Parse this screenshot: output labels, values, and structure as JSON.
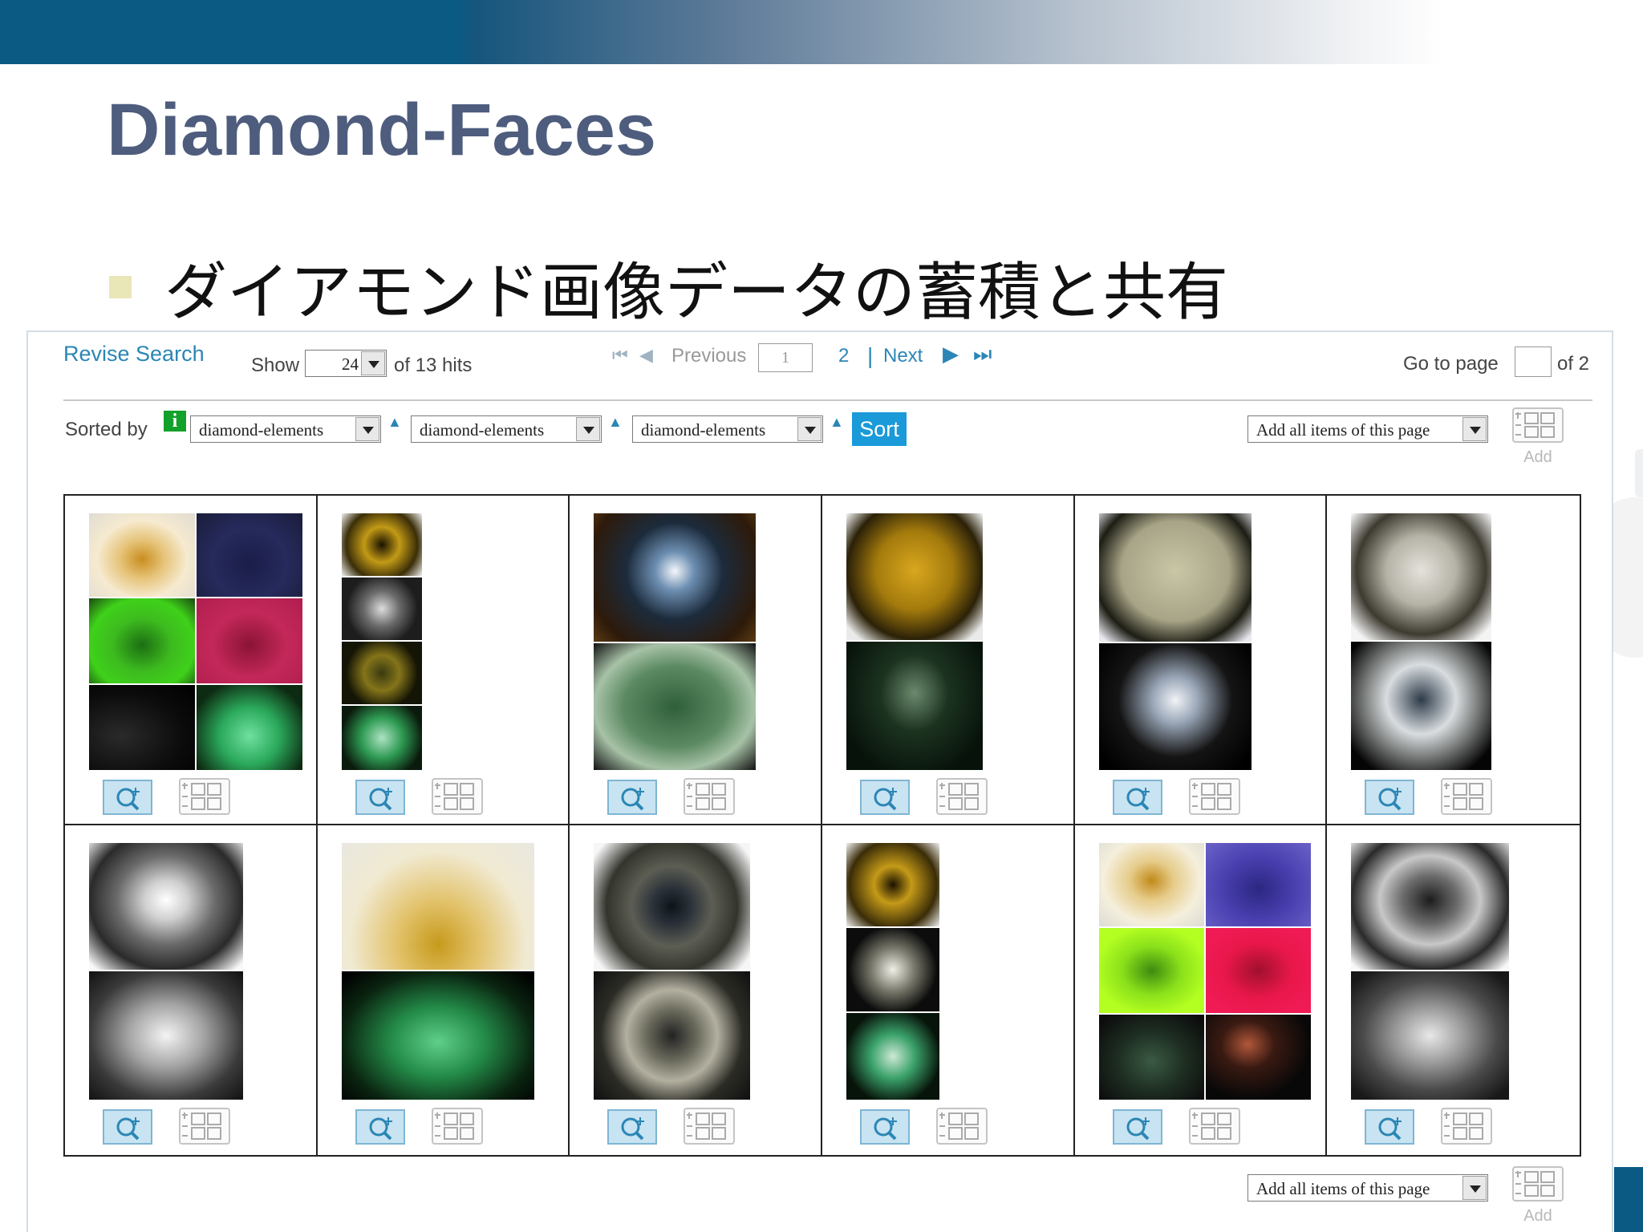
{
  "slide": {
    "title": "Diamond-Faces",
    "bullet": "ダイアモンド画像データの蓄積と共有"
  },
  "toolbar": {
    "revise_search": "Revise Search",
    "show_label": "Show",
    "show_value": "24",
    "hits_text": "of 13 hits",
    "previous_label": "Previous",
    "current_page": "1",
    "page_2": "2",
    "pipe": "|",
    "next_label": "Next",
    "goto_label": "Go to page",
    "goto_value": "",
    "goto_total": "of 2"
  },
  "sort": {
    "label": "Sorted by",
    "info_glyph": "i",
    "fields": [
      "diamond-elements",
      "diamond-elements",
      "diamond-elements"
    ],
    "sort_button": "Sort",
    "add_all_label": "Add all items of this page",
    "add_label": "Add"
  },
  "results": {
    "count": 12
  },
  "footer": {
    "add_all_label": "Add all items of this page",
    "add_label": "Add"
  },
  "colors": {
    "accent": "#2b86b5",
    "title": "#4e5c7d",
    "header_band": "#0a5a84",
    "sort_button": "#1a9ad9",
    "info_badge": "#12a12a"
  },
  "icons": {
    "zoom": "zoom-in-icon",
    "add": "add-to-collection-icon",
    "first": "first-page-icon",
    "prev": "previous-page-icon",
    "next": "next-page-icon",
    "last": "last-page-icon"
  }
}
